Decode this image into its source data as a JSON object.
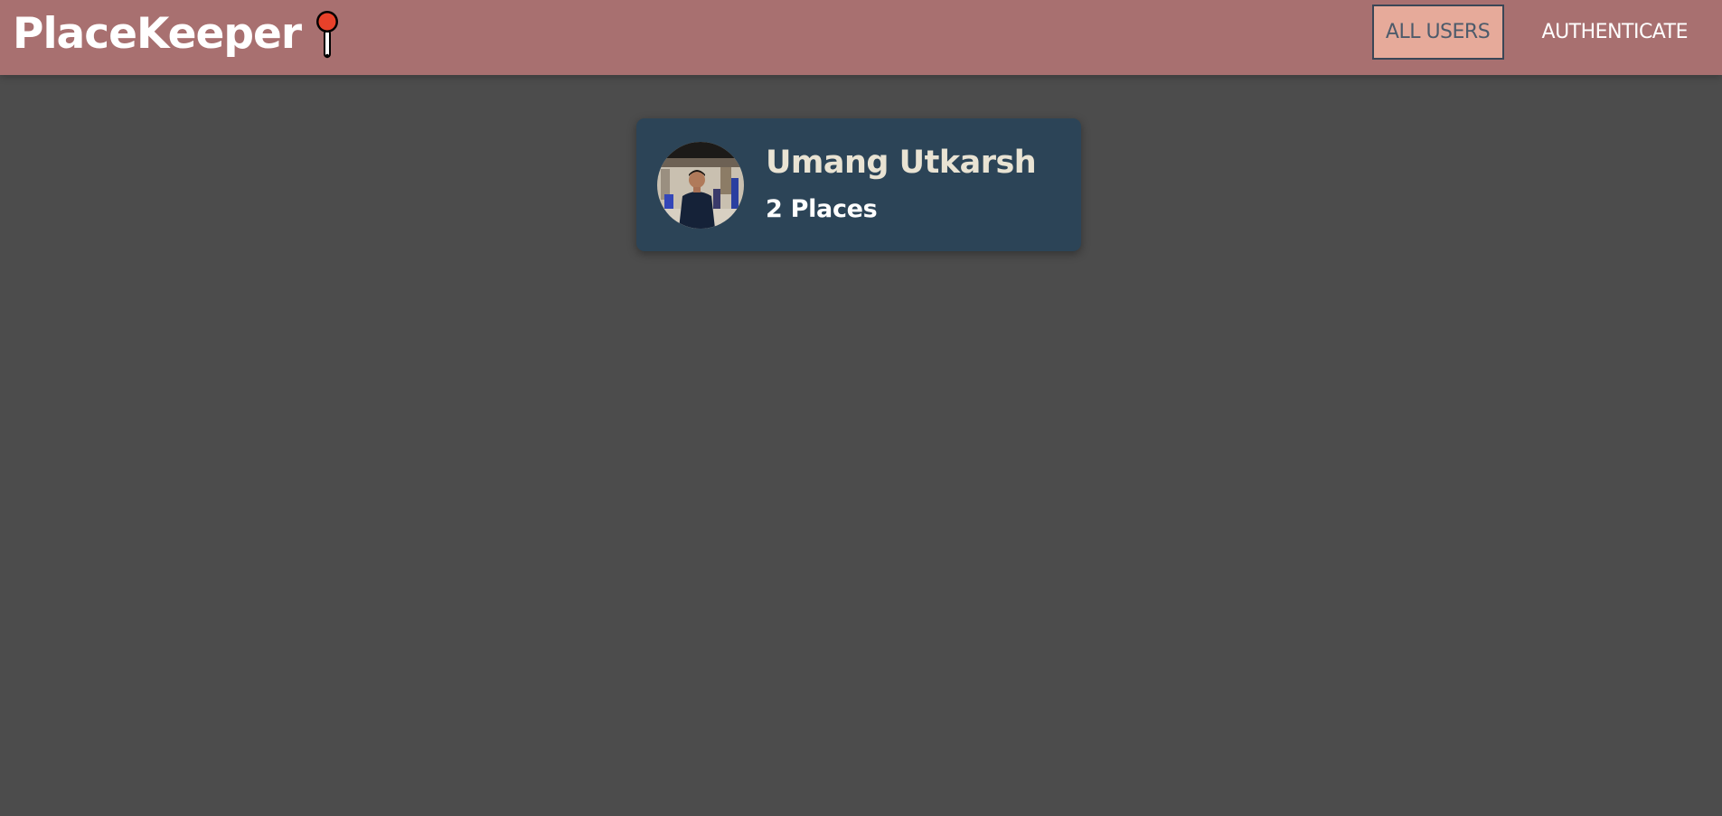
{
  "header": {
    "brand_title": "PlaceKeeper",
    "brand_icon": "map-pin-icon",
    "colors": {
      "bar": "#a87070",
      "active_nav_bg": "#e6aa9a",
      "pin": "#e8412a"
    },
    "nav": {
      "all_users_label": "ALL USERS",
      "authenticate_label": "AUTHENTICATE"
    }
  },
  "users": [
    {
      "name": "Umang Utkarsh",
      "places_label": "2 Places",
      "avatar": "user-photo-avatar"
    }
  ],
  "theme": {
    "page_bg": "#4c4c4c",
    "card_bg": "#2c4457",
    "name_color": "#e9e3d3"
  }
}
